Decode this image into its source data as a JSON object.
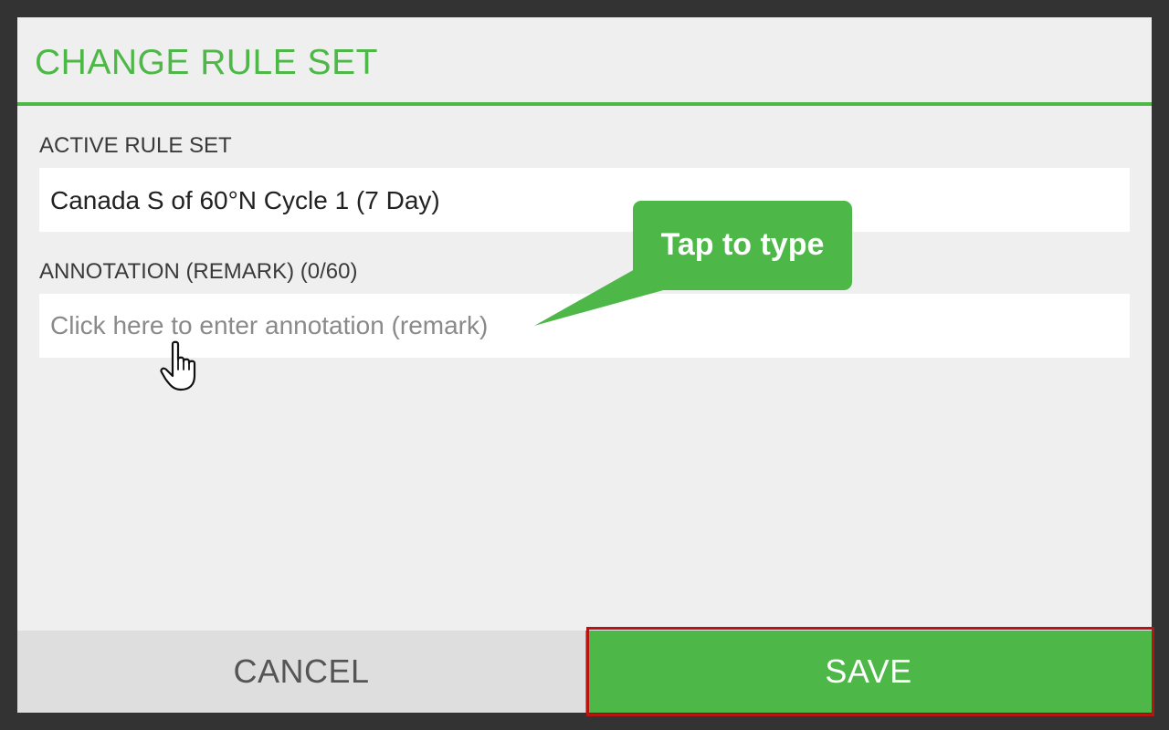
{
  "dialog": {
    "title": "CHANGE RULE SET",
    "active_rule_set": {
      "label": "ACTIVE RULE SET",
      "value": "Canada S of 60°N Cycle 1 (7 Day)"
    },
    "annotation": {
      "label": "ANNOTATION (REMARK) (0/60)",
      "value": "",
      "placeholder": "Click here to enter annotation (remark)"
    },
    "buttons": {
      "cancel_label": "CANCEL",
      "save_label": "SAVE"
    }
  },
  "overlay": {
    "callout_text": "Tap to type",
    "cursor_icon": "hand-pointer-icon"
  },
  "colors": {
    "accent": "#4db848",
    "highlight": "#b81414",
    "background": "#333333",
    "dialog_background": "#efefef"
  }
}
